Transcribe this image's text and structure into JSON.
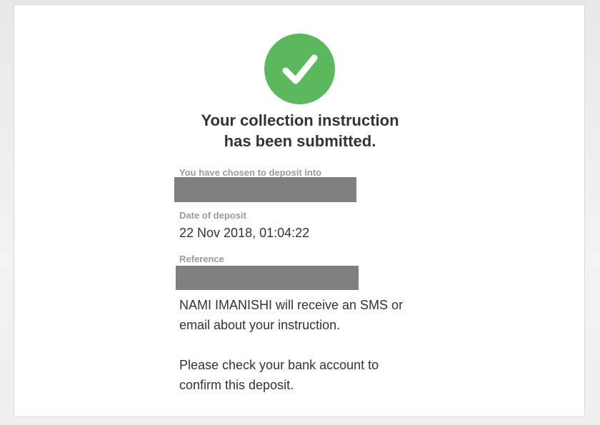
{
  "colors": {
    "success_green": "#5cb85c",
    "redaction_gray": "#808080",
    "label_gray": "#9a9a9a",
    "text_dark": "#333333"
  },
  "confirmation": {
    "icon": "checkmark-icon",
    "headline_line1": "Your collection instruction",
    "headline_line2": "has been submitted."
  },
  "details": {
    "deposit_into_label": "You have chosen to deposit into",
    "date_label": "Date of deposit",
    "date_value": "22 Nov 2018, 01:04:22",
    "reference_label": "Reference"
  },
  "messages": {
    "sms_notice_line1": "NAMI IMANISHI will receive an SMS or",
    "sms_notice_line2": "email about your instruction.",
    "check_notice_line1": "Please check your bank account to",
    "check_notice_line2": "confirm this deposit."
  }
}
